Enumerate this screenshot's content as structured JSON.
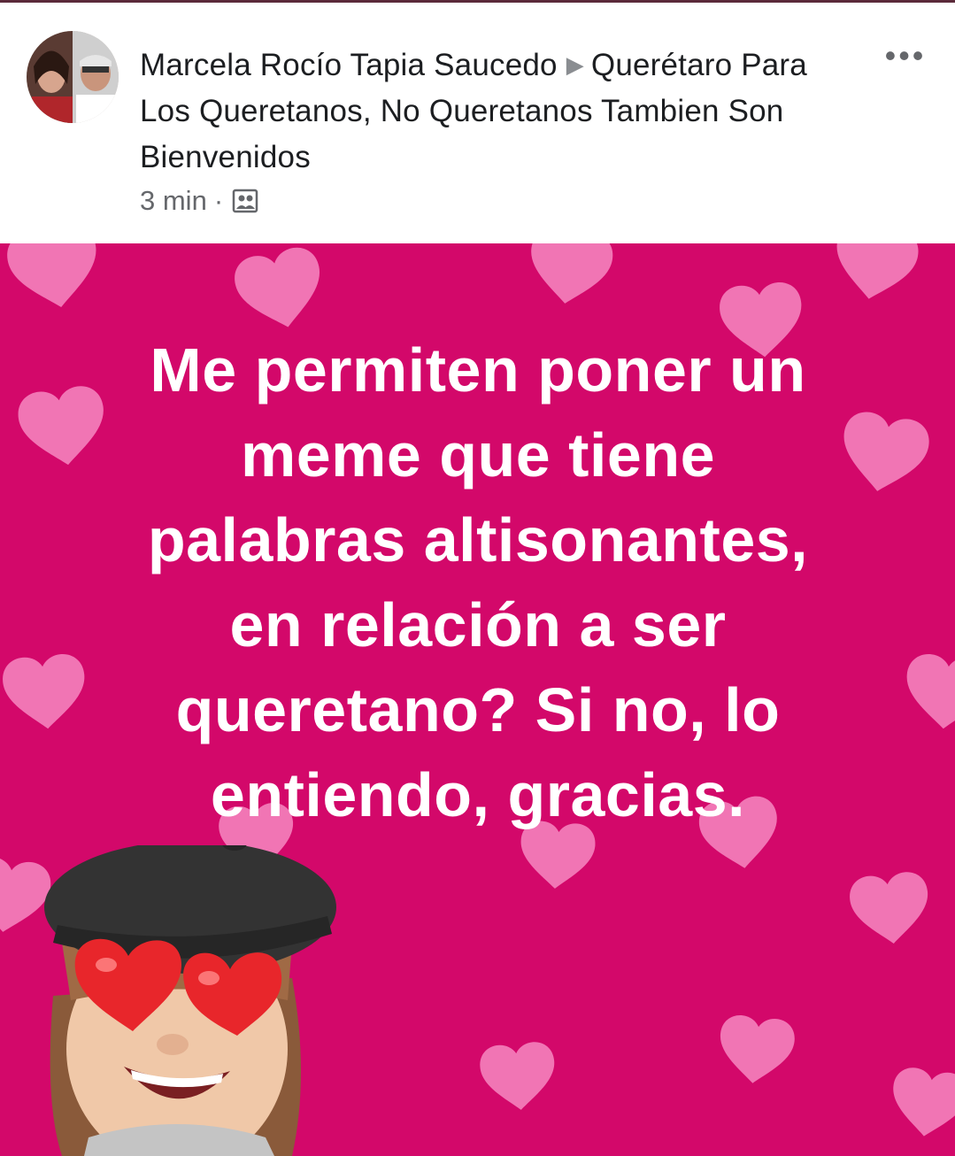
{
  "post": {
    "author": "Marcela Rocío Tapia Saucedo",
    "separator_icon": "triangle-right-icon",
    "group": "Querétaro Para Los Queretanos, No Queretanos Tambien Son Bienvenidos",
    "time": "3 min",
    "dot": "·",
    "audience_icon": "group-icon",
    "more_icon": "more-options-icon",
    "more_label": "•••"
  },
  "image": {
    "caption_lines": [
      "Me permiten poner un",
      "meme que tiene",
      "palabras altisonantes,",
      "en relación a ser",
      "queretano? Si no, lo",
      "entiendo, gracias."
    ],
    "background_color": "#d3086a",
    "heart_color": "#f27fb8",
    "character": "heart-eyes-avatar"
  }
}
